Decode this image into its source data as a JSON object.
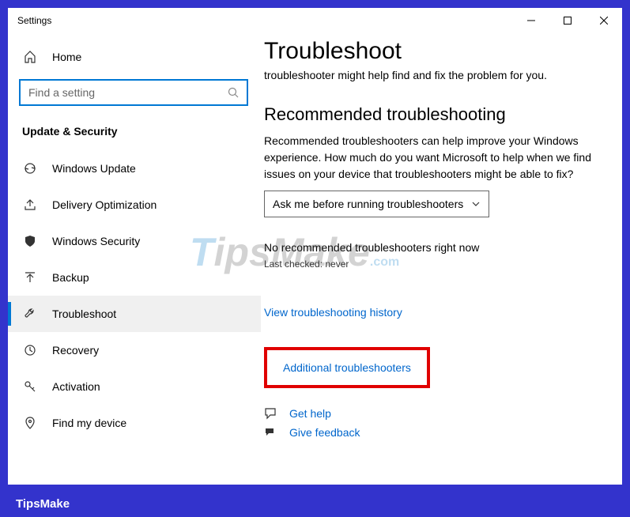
{
  "window": {
    "title": "Settings"
  },
  "sidebar": {
    "home": "Home",
    "searchPlaceholder": "Find a setting",
    "category": "Update & Security",
    "items": [
      {
        "label": "Windows Update"
      },
      {
        "label": "Delivery Optimization"
      },
      {
        "label": "Windows Security"
      },
      {
        "label": "Backup"
      },
      {
        "label": "Troubleshoot"
      },
      {
        "label": "Recovery"
      },
      {
        "label": "Activation"
      },
      {
        "label": "Find my device"
      }
    ]
  },
  "main": {
    "title": "Troubleshoot",
    "intro": "troubleshooter might help find and fix the problem for you.",
    "recHeading": "Recommended troubleshooting",
    "recDesc": "Recommended troubleshooters can help improve your Windows experience. How much do you want Microsoft to help when we find issues on your device that troubleshooters might be able to fix?",
    "dropdownValue": "Ask me before running troubleshooters",
    "noRec": "No recommended troubleshooters right now",
    "lastChecked": "Last checked: never",
    "viewHistory": "View troubleshooting history",
    "additional": "Additional troubleshooters",
    "getHelp": "Get help",
    "giveFeedback": "Give feedback"
  },
  "brand": "TipsMake"
}
